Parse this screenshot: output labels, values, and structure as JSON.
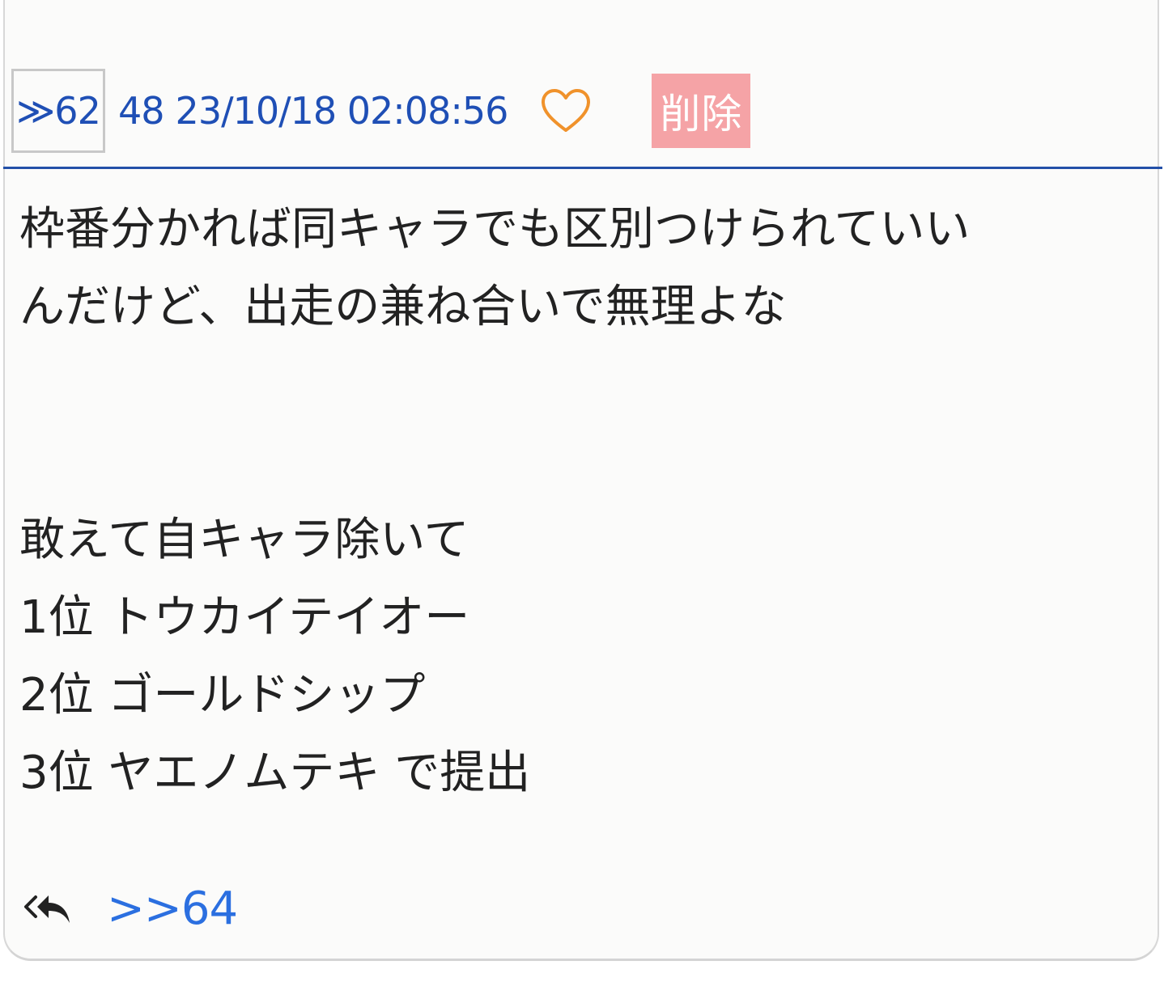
{
  "post": {
    "anchor": "≫62",
    "number": "48",
    "timestamp": "23/10/18 02:08:56",
    "delete_label": "削除",
    "body_lines": [
      "枠番分かれば同キャラでも区別つけられていい",
      "んだけど、出走の兼ね合いで無理よな",
      "",
      "",
      "敢えて自キャラ除いて",
      "1位 トウカイテイオー",
      "2位 ゴールドシップ",
      "3位 ヤエノムテキ で提出"
    ],
    "reply_link": ">>64"
  },
  "colors": {
    "accent": "#1f4fb5",
    "link": "#2b6fe0",
    "heart": "#f0922b",
    "delete_bg": "#f5a3a6",
    "divider": "#2350a8"
  },
  "icons": {
    "heart": "heart-outline-icon",
    "reply": "reply-all-icon"
  }
}
